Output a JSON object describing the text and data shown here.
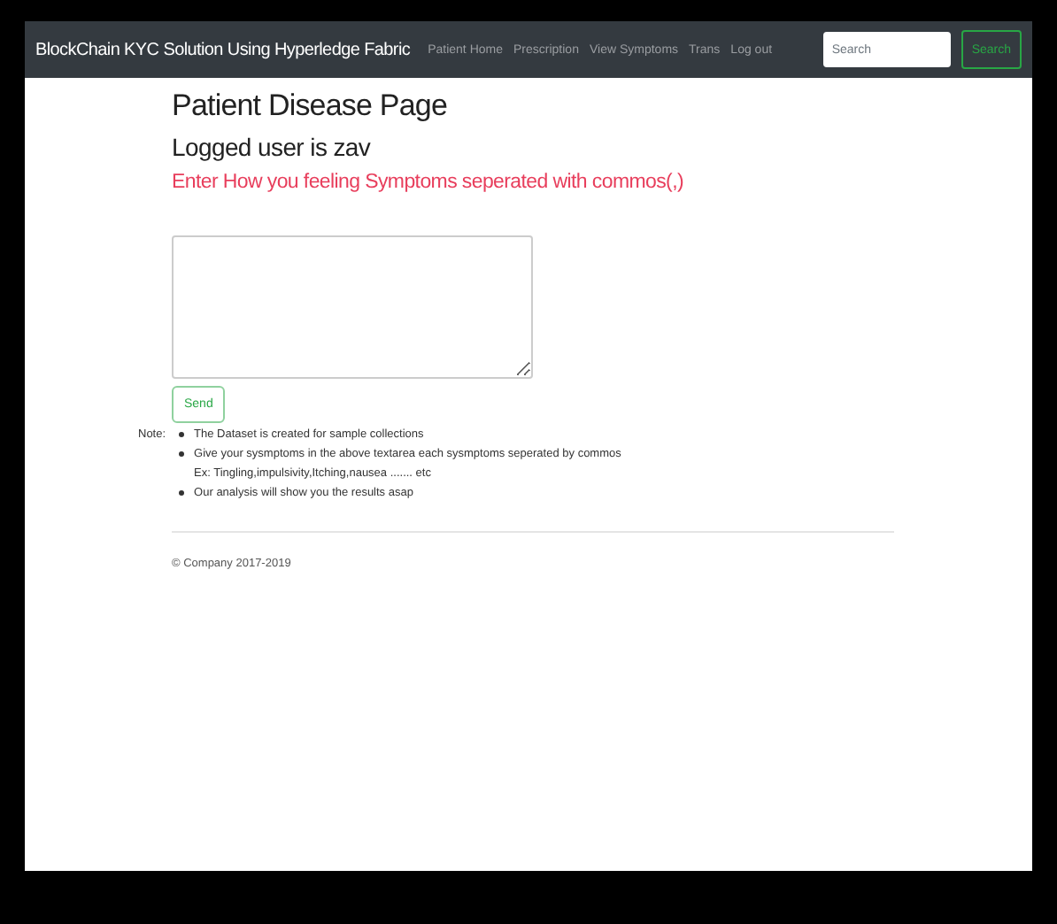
{
  "navbar": {
    "brand": "BlockChain KYC Solution Using Hyperledge Fabric",
    "links": [
      "Patient Home",
      "Prescription",
      "View Symptoms",
      "Trans",
      "Log out"
    ],
    "search": {
      "placeholder": "Search"
    },
    "search_button": "Search"
  },
  "heading": "Patient Disease Page",
  "logged_user": "Logged user is zav",
  "instruction": "Enter How you feeling Symptoms seperated with commos(,)",
  "send_button": "Send",
  "note": {
    "label": "Note:",
    "items": [
      {
        "text": "The Dataset is created for sample collections"
      },
      {
        "text": "Give your sysmptoms in the above textarea each sysmptoms seperated by commos",
        "children": [
          "Ex: Tingling,impulsivity,Itching,nausea ....... etc"
        ]
      },
      {
        "text": "Our analysis will show you the results asap"
      }
    ]
  },
  "footer": "© Company 2017-2019"
}
